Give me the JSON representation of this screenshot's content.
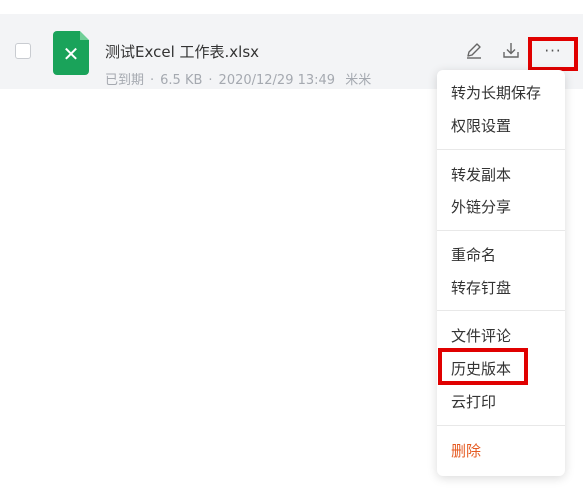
{
  "file": {
    "name": "测试Excel 工作表.xlsx",
    "status": "已到期",
    "sep": "·",
    "size": "6.5 KB",
    "datetime": "2020/12/29 13:49",
    "owner": "米米",
    "icon": "excel-file-icon",
    "icon_glyph": "✕"
  },
  "actions": {
    "rename_icon": "edit-icon",
    "download_icon": "download-icon",
    "more_label": "···"
  },
  "menu": {
    "groups": [
      [
        "转为长期保存",
        "权限设置"
      ],
      [
        "转发副本",
        "外链分享"
      ],
      [
        "重命名",
        "转存钉盘"
      ],
      [
        "文件评论",
        "历史版本",
        "云打印"
      ],
      [
        "删除"
      ]
    ]
  },
  "colors": {
    "excel_green": "#1aa35a",
    "highlight_red": "#e00000",
    "danger": "#e55b22"
  }
}
